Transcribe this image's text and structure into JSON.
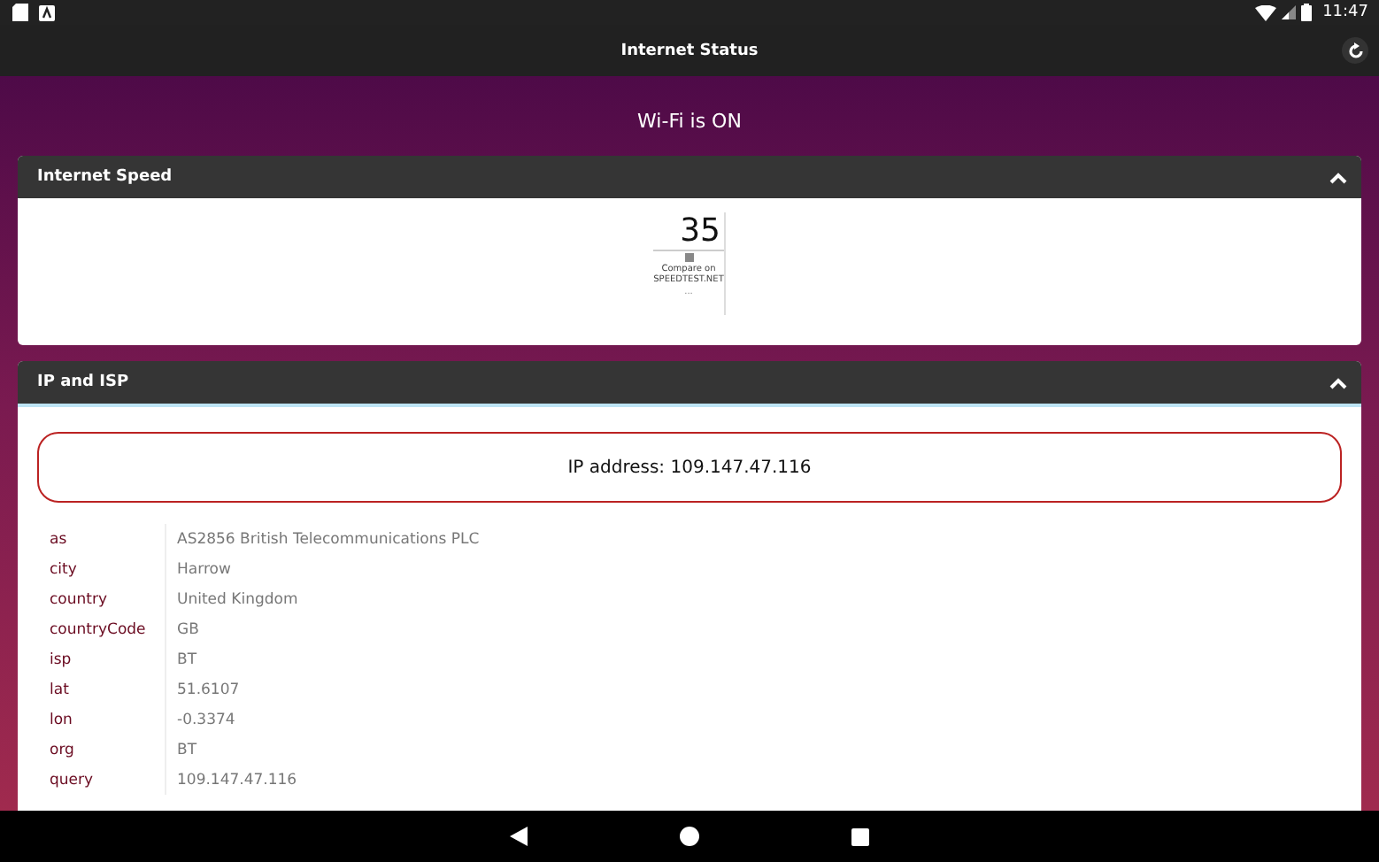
{
  "status_bar": {
    "time": "11:47"
  },
  "app_bar": {
    "title": "Internet Status"
  },
  "wifi_status": "Wi-Fi is ON",
  "speed_panel": {
    "title": "Internet Speed",
    "expanded": true,
    "speed": "35",
    "compare_text": "Compare on SPEEDTEST.NET",
    "footer": "..."
  },
  "ip_panel": {
    "title": "IP and ISP",
    "expanded": true,
    "ip_address": "IP address: 109.147.47.116",
    "rows": [
      {
        "key": "as",
        "value": "AS2856 British Telecommunications PLC"
      },
      {
        "key": "city",
        "value": "Harrow"
      },
      {
        "key": "country",
        "value": "United Kingdom"
      },
      {
        "key": "countryCode",
        "value": "GB"
      },
      {
        "key": "isp",
        "value": "BT"
      },
      {
        "key": "lat",
        "value": "51.6107"
      },
      {
        "key": "lon",
        "value": "-0.3374"
      },
      {
        "key": "org",
        "value": "BT"
      },
      {
        "key": "query",
        "value": "109.147.47.116"
      }
    ]
  }
}
